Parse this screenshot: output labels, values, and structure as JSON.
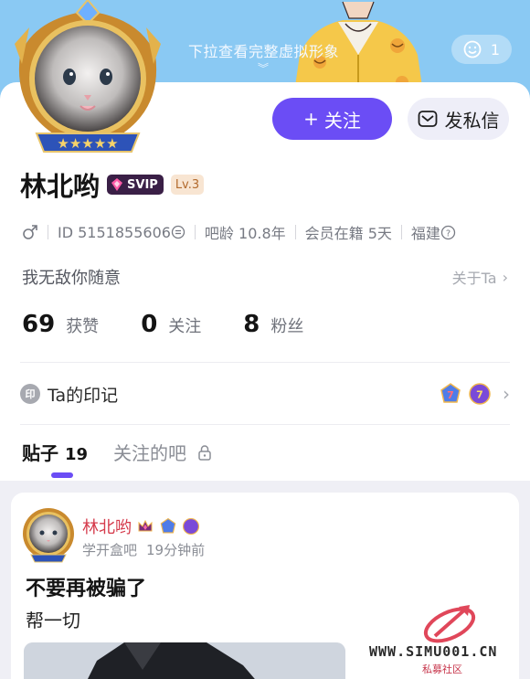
{
  "header": {
    "pull_hint": "下拉查看完整虚拟形象",
    "emoji_count": "1"
  },
  "actions": {
    "follow_label": "关注",
    "follow_prefix": "+",
    "message_label": "发私信"
  },
  "profile": {
    "username": "林北哟",
    "svip_label": "SVIP",
    "level_label": "Lv.3",
    "id_text": "ID 5151855606",
    "bar_age": "吧龄 10.8年",
    "membership": "会员在籍 5天",
    "location": "福建",
    "bio": "我无敌你随意",
    "about_link": "关于Ta"
  },
  "stats": [
    {
      "num": "69",
      "label": "获赞"
    },
    {
      "num": "0",
      "label": "关注"
    },
    {
      "num": "8",
      "label": "粉丝"
    }
  ],
  "seal": {
    "icon_char": "印",
    "label": "Ta的印记",
    "badge_1": "7",
    "badge_2": "7"
  },
  "tabs": {
    "posts_label": "贴子",
    "posts_count": "19",
    "followed_bars_label": "关注的吧"
  },
  "post": {
    "author": "林北哟",
    "bar_name": "学开盒吧",
    "time_ago": "19分钟前",
    "title": "不要再被骗了",
    "body": "帮一切"
  },
  "watermark": {
    "url": "WWW.SIMU001.CN",
    "sub": "私募社区"
  },
  "colors": {
    "accent": "#6b4df5",
    "banner": "#8ac9f3",
    "author_red": "#d53a4b"
  }
}
